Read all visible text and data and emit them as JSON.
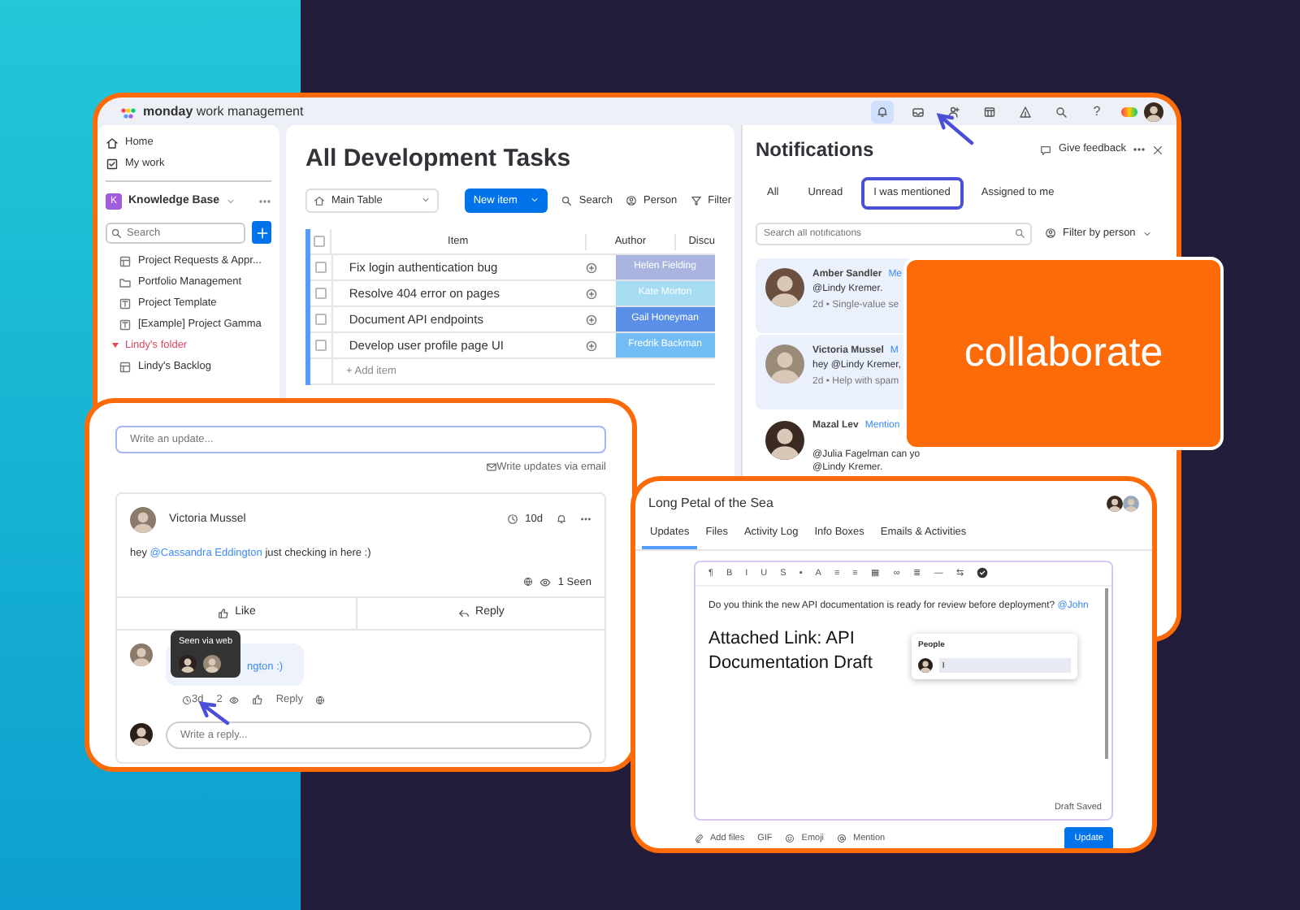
{
  "main_window": {
    "brand": {
      "name": "monday",
      "suffix": "work management"
    },
    "topbar_icons": [
      {
        "kind": "bell",
        "selected": true
      },
      {
        "kind": "tray",
        "selected": false
      },
      {
        "kind": "person-add",
        "selected": false
      },
      {
        "kind": "grid",
        "selected": false
      },
      {
        "kind": "triangle",
        "selected": false
      },
      {
        "kind": "search",
        "selected": false
      },
      {
        "kind": "text",
        "label": "?",
        "selected": false
      }
    ],
    "sidebar": {
      "nav": [
        {
          "kind": "home",
          "label": "Home"
        },
        {
          "kind": "check",
          "label": "My work"
        }
      ],
      "workspace": {
        "badge": "K",
        "name": "Knowledge Base"
      },
      "search": {
        "placeholder": "Search"
      },
      "items": [
        {
          "kind": "board",
          "label": "Project Requests & Appr..."
        },
        {
          "kind": "folder",
          "label": "Portfolio Management"
        },
        {
          "kind": "template",
          "label": "Project Template"
        },
        {
          "kind": "template",
          "label": "[Example] Project Gamma"
        }
      ],
      "folder": {
        "label": "Lindy's folder",
        "expanded": true,
        "children": [
          {
            "label": "Lindy's Backlog"
          }
        ]
      }
    },
    "board": {
      "title": "All Development Tasks",
      "view": "Main Table",
      "new_item": "New item",
      "tools": [
        {
          "kind": "search",
          "label": "Search"
        },
        {
          "kind": "person",
          "label": "Person"
        },
        {
          "kind": "filter",
          "label": "Filter"
        }
      ],
      "all_checked": false,
      "columns": [
        "Item",
        "Author",
        "Discu"
      ],
      "rows": [
        {
          "item": "Fix login authentication bug",
          "author": "Helen Fielding",
          "color": "#a9b5e0",
          "checked": false
        },
        {
          "item": "Resolve 404 error on pages",
          "author": "Kate Morton",
          "color": "#a6dcf2",
          "checked": false
        },
        {
          "item": "Document API endpoints",
          "author": "Gail Honeyman",
          "color": "#5b8fe8",
          "checked": false
        },
        {
          "item": "Develop user profile page UI",
          "author": "Fredrik Backman",
          "color": "#72bdf6",
          "checked": false
        }
      ],
      "add_item": "+ Add item"
    },
    "notifications": {
      "title": "Notifications",
      "feedback": "Give feedback",
      "tabs": [
        {
          "label": "All",
          "selected": false
        },
        {
          "label": "Unread",
          "selected": false
        },
        {
          "label": "I was mentioned",
          "selected": true
        },
        {
          "label": "Assigned to me",
          "selected": false
        }
      ],
      "search": {
        "placeholder": "Search all notifications"
      },
      "filter": "Filter by person",
      "items": [
        {
          "name": "Amber Sandler",
          "mention": "Me",
          "message": "@Lindy Kremer.",
          "meta": "2d • Single-value se",
          "unread": true
        },
        {
          "name": "Victoria Mussel",
          "mention": "M",
          "message": "hey @Lindy Kremer,",
          "meta": "2d • Help with spam",
          "unread": true
        },
        {
          "name": "Mazal Lev",
          "mention": "Mention",
          "message": "@Julia Fagelman can yo",
          "message_2": "@Lindy Kremer.",
          "unread": false
        }
      ]
    }
  },
  "headline": "collaborate",
  "update_card": {
    "field": {
      "placeholder": "Write an update..."
    },
    "email_link": "Write updates via email",
    "post": {
      "author": "Victoria Mussel",
      "time": "10d",
      "text_before": "hey ",
      "mention": "@Cassandra Eddington",
      "text_after": " just checking in here :)",
      "seen": "1 Seen",
      "like": "Like",
      "reply": "Reply"
    },
    "comment": {
      "bubble_text": "ngton :)",
      "tooltip": "Seen via web",
      "time": "3d",
      "views": "2",
      "reply": "Reply"
    },
    "reply_field": {
      "placeholder": "Write a reply..."
    }
  },
  "editor_card": {
    "title": "Long Petal of the Sea",
    "tabs": [
      {
        "label": "Updates",
        "selected": true
      },
      {
        "label": "Files",
        "selected": false
      },
      {
        "label": "Activity Log",
        "selected": false
      },
      {
        "label": "Info Boxes",
        "selected": false
      },
      {
        "label": "Emails & Activities",
        "selected": false
      }
    ],
    "toolbar": [
      "¶",
      "B",
      "I",
      "U",
      "S",
      "▪",
      "A",
      "≡",
      "≡",
      "▦",
      "∞",
      "≣",
      "—",
      "⇆"
    ],
    "question": "Do you think the new API documentation is ready for review before deployment? ",
    "mention": "@John",
    "attachment": "Attached Link: API Documentation Draft",
    "people_popup": {
      "title": "People",
      "value": "l"
    },
    "status": "Draft Saved",
    "footer": [
      {
        "kind": "clip",
        "label": "Add files"
      },
      {
        "kind": "none",
        "label": "GIF"
      },
      {
        "kind": "smile",
        "label": "Emoji"
      },
      {
        "kind": "at",
        "label": "Mention"
      }
    ],
    "submit": "Update"
  }
}
